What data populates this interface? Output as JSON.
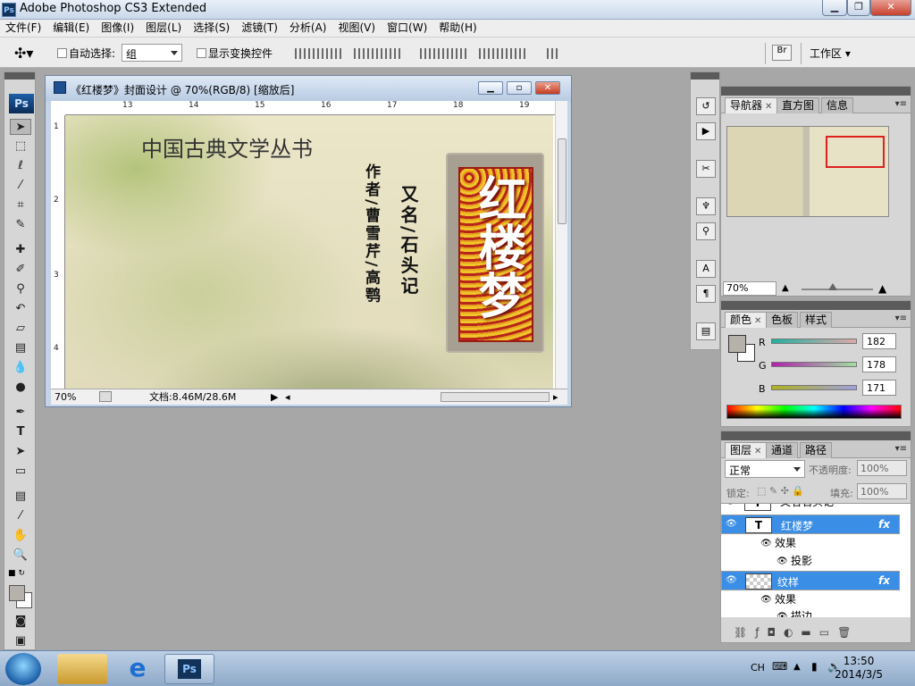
{
  "app": {
    "title": "Adobe Photoshop CS3 Extended",
    "logo": "Ps"
  },
  "menu": [
    "文件(F)",
    "编辑(E)",
    "图像(I)",
    "图层(L)",
    "选择(S)",
    "滤镜(T)",
    "分析(A)",
    "视图(V)",
    "窗口(W)",
    "帮助(H)"
  ],
  "options": {
    "auto_select_label": "自动选择:",
    "auto_select_value": "组",
    "show_transform_label": "显示变换控件",
    "workspace_label": "工作区"
  },
  "document": {
    "title": "《红楼梦》封面设计 @ 70%(RGB/8) [缩放后]",
    "zoom": "70%",
    "doc_info": "文档:8.46M/28.6M",
    "ruler_h": [
      "13",
      "14",
      "15",
      "16",
      "17",
      "18",
      "19"
    ],
    "ruler_v": [
      "1",
      "2",
      "3",
      "4"
    ]
  },
  "artwork": {
    "series_title": "中国古典文学丛书",
    "author_col1": "作者/曹雪芹/高鹗",
    "alias_col": "又名/石头记",
    "book_title": "红楼梦"
  },
  "navigator": {
    "tabs": [
      "导航器",
      "直方图",
      "信息"
    ],
    "zoom": "70%"
  },
  "color": {
    "tabs": [
      "颜色",
      "色板",
      "样式"
    ],
    "r_label": "R",
    "g_label": "G",
    "b_label": "B",
    "r": "182",
    "g": "178",
    "b": "171",
    "fg_color": "#b6b2ab"
  },
  "layers": {
    "tabs": [
      "图层",
      "通道",
      "路径"
    ],
    "blend_mode": "正常",
    "opacity_label": "不透明度:",
    "opacity": "100%",
    "lock_label": "锁定:",
    "fill_label": "填充:",
    "fill": "100%",
    "rows": [
      {
        "name": "又名石头记",
        "type": "text"
      },
      {
        "name": "红楼梦",
        "type": "text",
        "fx": "fx"
      },
      {
        "name": "效果",
        "type": "effect"
      },
      {
        "name": "投影",
        "type": "effect-item"
      },
      {
        "name": "纹样",
        "type": "image",
        "fx": "fx"
      },
      {
        "name": "效果",
        "type": "effect"
      },
      {
        "name": "描边",
        "type": "effect-item"
      }
    ],
    "thumb_text": "T"
  },
  "taskbar": {
    "lang": "CH",
    "time": "13:50",
    "date": "2014/3/5"
  },
  "colors": {
    "accent": "#3a8ee6",
    "panel": "#d6d6d6"
  }
}
